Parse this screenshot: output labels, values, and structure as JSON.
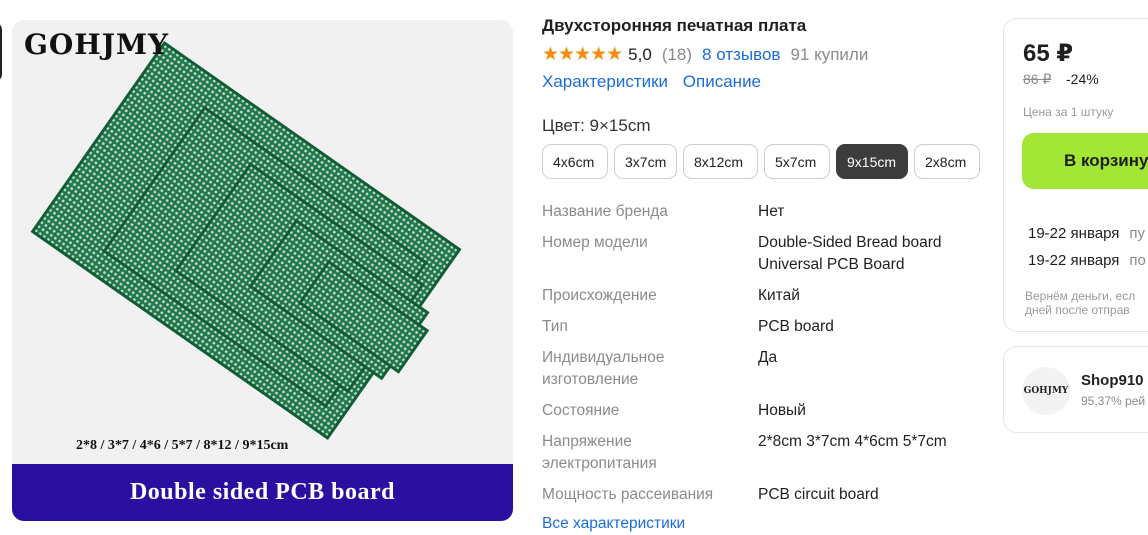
{
  "gallery": {
    "logo": "GOHJMY",
    "sizes_caption": "2*8 / 3*7 / 4*6 / 5*7 / 8*12 / 9*15cm",
    "banner": "Double sided PCB board"
  },
  "product": {
    "title": "Двухсторонняя печатная плата",
    "stars": "★★★★★",
    "rating": "5,0",
    "rating_count": "(18)",
    "reviews_link": "8 отзывов",
    "bought": "91 купили",
    "links": [
      "Характеристики",
      "Описание"
    ],
    "color_label": "Цвет: 9×15cm",
    "options": [
      "4x6cm",
      "3x7cm",
      "8x12cm",
      "5x7cm",
      "9x15cm",
      "2x8cm"
    ],
    "selected_option": "9x15cm",
    "specs": [
      {
        "k": "Название бренда",
        "v": "Нет"
      },
      {
        "k": "Номер модели",
        "v": "Double-Sided Bread board Universal PCB Board"
      },
      {
        "k": "Происхождение",
        "v": "Китай"
      },
      {
        "k": "Тип",
        "v": "PCB board"
      },
      {
        "k": "Индивидуальное изготовление",
        "v": "Да"
      },
      {
        "k": "Состояние",
        "v": "Новый"
      },
      {
        "k": "Напряжение электропитания",
        "v": "2*8cm 3*7cm 4*6cm 5*7cm"
      },
      {
        "k": "Мощность рассеивания",
        "v": "PCB circuit board"
      }
    ],
    "all_specs_link": "Все характеристики"
  },
  "buy": {
    "price": "65 ₽",
    "old_price": "86 ₽",
    "discount": "-24%",
    "per_unit": "Цена за 1 штуку",
    "cart_button": "В корзину",
    "delivery": [
      {
        "date": "19-22 января",
        "hint": "пу"
      },
      {
        "date": "19-22 января",
        "hint": "по"
      }
    ],
    "refund_line1": "Вернём деньги, есл",
    "refund_line2": "дней после отправ"
  },
  "shop": {
    "avatar_text": "GOHJMY",
    "name": "Shop910",
    "rating": "95,37% рей"
  },
  "colors": {
    "accent_link": "#1b6dd9",
    "star": "#f88b0b",
    "cart_button": "#a3e635",
    "banner": "#2a0fa1",
    "chip_selected": "#3c3c3c"
  }
}
